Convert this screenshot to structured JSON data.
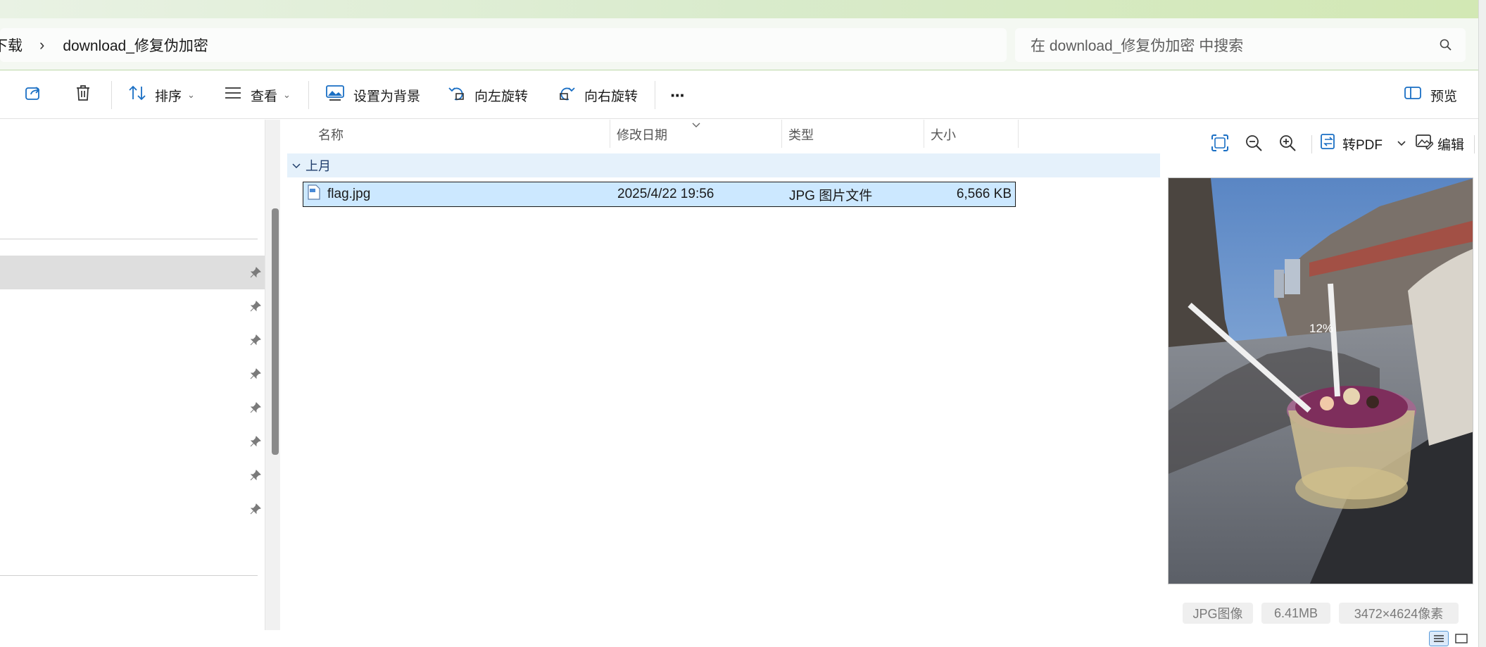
{
  "address": {
    "prev_crumb": "下载",
    "current_crumb": "download_修复伪加密",
    "search_placeholder": "在 download_修复伪加密 中搜索"
  },
  "toolbar": {
    "sort_label": "排序",
    "view_label": "查看",
    "set_background_label": "设置为背景",
    "rotate_left_label": "向左旋转",
    "rotate_right_label": "向右旋转",
    "more_label": "···",
    "preview_label": "预览"
  },
  "columns": {
    "name": "名称",
    "modified": "修改日期",
    "type": "类型",
    "size": "大小"
  },
  "group": {
    "label": "上月"
  },
  "files": [
    {
      "name": "flag.jpg",
      "modified": "2025/4/22 19:56",
      "type": "JPG 图片文件",
      "size": "6,566 KB"
    }
  ],
  "preview_pane": {
    "to_pdf_label": "转PDF",
    "edit_label": "编辑",
    "zoom_overlay": "12%",
    "format_chip": "JPG图像",
    "size_chip": "6.41MB",
    "dimensions_chip": "3472×4624像素"
  },
  "colors": {
    "accent": "#005fb8",
    "selection": "#cce8ff",
    "group_bg": "#e5f1fb",
    "titlebar_green": "#d2e8b4"
  }
}
